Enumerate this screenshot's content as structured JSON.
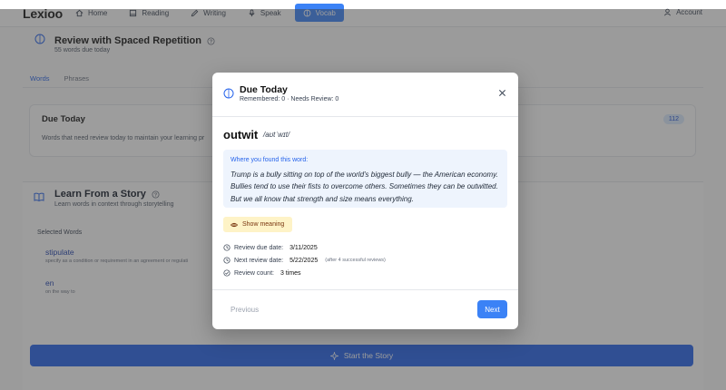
{
  "app": {
    "logo": "Lexioo"
  },
  "nav": {
    "items": [
      {
        "label": "Home",
        "icon": "home-icon"
      },
      {
        "label": "Reading",
        "icon": "book-icon"
      },
      {
        "label": "Writing",
        "icon": "pen-icon"
      },
      {
        "label": "Speak",
        "icon": "mic-icon"
      },
      {
        "label": "Vocab",
        "icon": "brain-icon",
        "active": true
      }
    ],
    "account": "Account"
  },
  "review": {
    "title": "Review with Spaced Repetition",
    "subtitle": "55 words due today",
    "tabs": [
      "Words",
      "Phrases"
    ],
    "due_title": "Due Today",
    "due_desc": "Words that need review today to maintain your learning pr",
    "due_count": "112"
  },
  "story": {
    "title": "Learn From a Story",
    "subtitle": "Learn words in context through storytelling",
    "selected_label": "Selected Words",
    "words": [
      {
        "word": "stipulate",
        "def": "specify as a condition or requirement in an agreement or regulati"
      },
      {
        "word": "en",
        "def": "on the way to"
      }
    ],
    "start_label": "Start the Story"
  },
  "modal": {
    "title": "Due Today",
    "stats": "Remembered: 0 · Needs Review: 0",
    "word": "outwit",
    "phonetic": "/aʊtˈwɪt/",
    "context_label": "Where you found this word:",
    "context_text": "Trump is a bully sitting on top of the world's biggest bully — the American economy. Bullies tend to use their fists to overcome others. Sometimes they can be outwitted. But we all know that strength and size means everything.",
    "show_meaning": "Show meaning",
    "due_date_label": "Review due date:",
    "due_date": "3/11/2025",
    "next_review_label": "Next review date:",
    "next_review": "5/22/2025",
    "next_review_note": "(after 4 successful reviews)",
    "count_label": "Review count:",
    "count": "3 times",
    "prev": "Previous",
    "next": "Next"
  },
  "colors": {
    "accent": "#3b82f6",
    "highlight": "#fef3c7",
    "context_bg": "#eef4fd"
  }
}
